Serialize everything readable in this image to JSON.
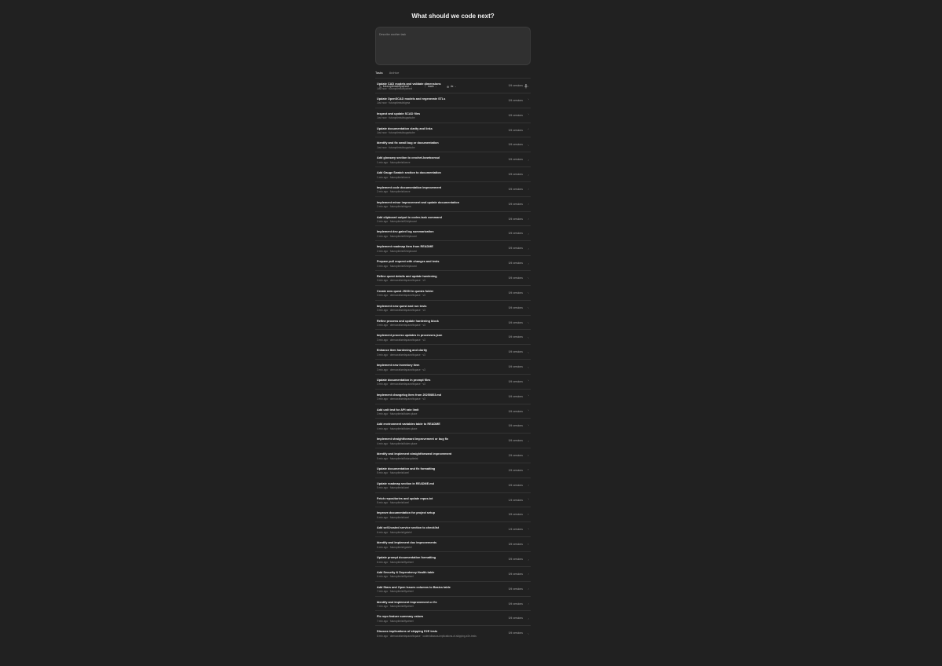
{
  "header": {
    "title": "What should we code next?"
  },
  "composer": {
    "placeholder": "Describe another task",
    "repo": "futuroptimist/flywheel",
    "branch": "main",
    "count": "4x"
  },
  "tabs": [
    {
      "label": "Tasks",
      "active": true
    },
    {
      "label": "Archive",
      "active": false
    }
  ],
  "tasks": [
    {
      "title": "Update CAD models and validate dimensions",
      "meta": "Just now · futuroptimist/flywheel",
      "versions": "0/4 versions",
      "status": "◟"
    },
    {
      "title": "Update OpenSCAD models and regenerate STLs",
      "meta": "Just now · futuroptimist/sigma",
      "versions": "0/4 versions",
      "status": "◝"
    },
    {
      "title": "Inspect and update SCAD files",
      "meta": "Just now · futuroptimist/sugarkube",
      "versions": "0/4 versions",
      "status": "◝"
    },
    {
      "title": "Update documentation clarity and links",
      "meta": "Just now · futuroptimist/sugarkube",
      "versions": "0/4 versions",
      "status": "◜"
    },
    {
      "title": "Identify and fix small bug or documentation",
      "meta": "Just now · futuroptimist/sugarkube",
      "versions": "0/4 versions",
      "status": "◟"
    },
    {
      "title": "Add glossary section to crochet-bowtconsul",
      "meta": "1 min ago · futuroptimist/wove",
      "versions": "0/4 versions",
      "status": "◞"
    },
    {
      "title": "Add Gauge Swatch section to documentation",
      "meta": "1 min ago · futuroptimist/wove",
      "versions": "0/4 versions",
      "status": "◞"
    },
    {
      "title": "Implement code documentation improvement",
      "meta": "2 min ago · futuroptimist/wove",
      "versions": "0/4 versions",
      "status": "◞"
    },
    {
      "title": "Implement minor improvement and update documentation",
      "meta": "2 min ago · futuroptimist/sigma",
      "versions": "0/4 versions",
      "status": "◞"
    },
    {
      "title": "Add clipboard output to codex-task command",
      "meta": "2 min ago · futuroptimist/f2clipboard",
      "versions": "0/4 versions",
      "status": "◞"
    },
    {
      "title": "Implement dev-gated log summarization",
      "meta": "2 min ago · futuroptimist/f2clipboard",
      "versions": "0/4 versions",
      "status": "◞"
    },
    {
      "title": "Implement roadmap item from README",
      "meta": "2 min ago · futuroptimist/f2clipboard",
      "versions": "0/4 versions",
      "status": "◞"
    },
    {
      "title": "Prepare pull request with changes and tests",
      "meta": "3 min ago · futuroptimist/f2clipboard",
      "versions": "0/4 versions",
      "status": "◞"
    },
    {
      "title": "Refine quest details and update hardening",
      "meta": "3 min ago · democratizedspace/dspace · v3",
      "versions": "0/4 versions",
      "status": "◟"
    },
    {
      "title": "Create new quest JSON in quests folder",
      "meta": "3 min ago · democratizedspace/dspace · v3",
      "versions": "0/4 versions",
      "status": "◟"
    },
    {
      "title": "Implement new quest and run tests",
      "meta": "3 min ago · democratizedspace/dspace · v3",
      "versions": "0/4 versions",
      "status": "◟"
    },
    {
      "title": "Refine process and update hardening block",
      "meta": "3 min ago · democratizedspace/dspace · v3",
      "versions": "0/4 versions",
      "status": "◟"
    },
    {
      "title": "Implement process updates in processes.json",
      "meta": "3 min ago · democratizedspace/dspace · v3",
      "versions": "0/4 versions",
      "status": "◟"
    },
    {
      "title": "Enhance item hardening and clarity",
      "meta": "3 min ago · democratizedspace/dspace · v3",
      "versions": "0/4 versions",
      "status": "◟"
    },
    {
      "title": "Implement new inventory item",
      "meta": "3 min ago · democratizedspace/dspace · v3",
      "versions": "0/4 versions",
      "status": "◟"
    },
    {
      "title": "Update documentation in prompt files",
      "meta": "3 min ago · democratizedspace/dspace · v3",
      "versions": "0/4 versions",
      "status": "◝"
    },
    {
      "title": "Implement changelog item from 20250803.md",
      "meta": "3 min ago · democratizedspace/dspace · v3",
      "versions": "0/4 versions",
      "status": "◝"
    },
    {
      "title": "Add unit test for API rate limit",
      "meta": "3 min ago · futuroptimist/token.place",
      "versions": "0/4 versions",
      "status": "◝"
    },
    {
      "title": "Add environment variables table to README",
      "meta": "4 min ago · futuroptimist/token.place",
      "versions": "0/4 versions",
      "status": "◝"
    },
    {
      "title": "Implement straightforward improvement or bug fix",
      "meta": "4 min ago · futuroptimist/token.place",
      "versions": "0/4 versions",
      "status": "◞"
    },
    {
      "title": "Identify and implement straightforward improvement",
      "meta": "5 min ago · futuroptimist/futuroptimist",
      "versions": "2/4 versions",
      "status": "◌"
    },
    {
      "title": "Update documentation and fix formatting",
      "meta": "5 min ago · futuroptimist/axel",
      "versions": "2/4 versions",
      "status": "◌"
    },
    {
      "title": "Update roadmap section in README.md",
      "meta": "5 min ago · futuroptimist/axel",
      "versions": "0/4 versions",
      "status": "◞"
    },
    {
      "title": "Fetch repositories and update repos.txt",
      "meta": "5 min ago · futuroptimist/axel",
      "versions": "1/4 versions",
      "status": "◝"
    },
    {
      "title": "Improve documentation for project setup",
      "meta": "6 min ago · futuroptimist/axel",
      "versions": "3/4 versions",
      "status": "◌"
    },
    {
      "title": "Add self-hosted service section to checklist",
      "meta": "6 min ago · futuroptimist/gabriel",
      "versions": "1/4 versions",
      "status": "◝"
    },
    {
      "title": "Identify and implement doc improvements",
      "meta": "6 min ago · futuroptimist/gabriel",
      "versions": "3/4 versions",
      "status": "◌"
    },
    {
      "title": "Update prompt documentation formatting",
      "meta": "6 min ago · futuroptimist/flywheel",
      "versions": "0/4 versions",
      "status": "◞"
    },
    {
      "title": "Add Security & Dependency Health table",
      "meta": "6 min ago · futuroptimist/flywheel",
      "versions": "0/4 versions",
      "status": "◞"
    },
    {
      "title": "Add Stars and Open Issues columns to Basics table",
      "meta": "7 min ago · futuroptimist/flywheel",
      "versions": "0/4 versions",
      "status": "◞"
    },
    {
      "title": "Identify and implement improvement or fix",
      "meta": "7 min ago · futuroptimist/flywheel",
      "versions": "0/4 versions",
      "status": "◞"
    },
    {
      "title": "Fix repo feature summary values",
      "meta": "7 min ago · futuroptimist/flywheel",
      "versions": "0/4 versions",
      "status": "◞"
    },
    {
      "title": "Discuss implications of skipping E2E tests",
      "meta": "8 min ago · democratizedspace/dspace · codex/discuss-implications-of-skipping-e2e-tests",
      "versions": "0/4 versions",
      "status": "◟"
    }
  ]
}
